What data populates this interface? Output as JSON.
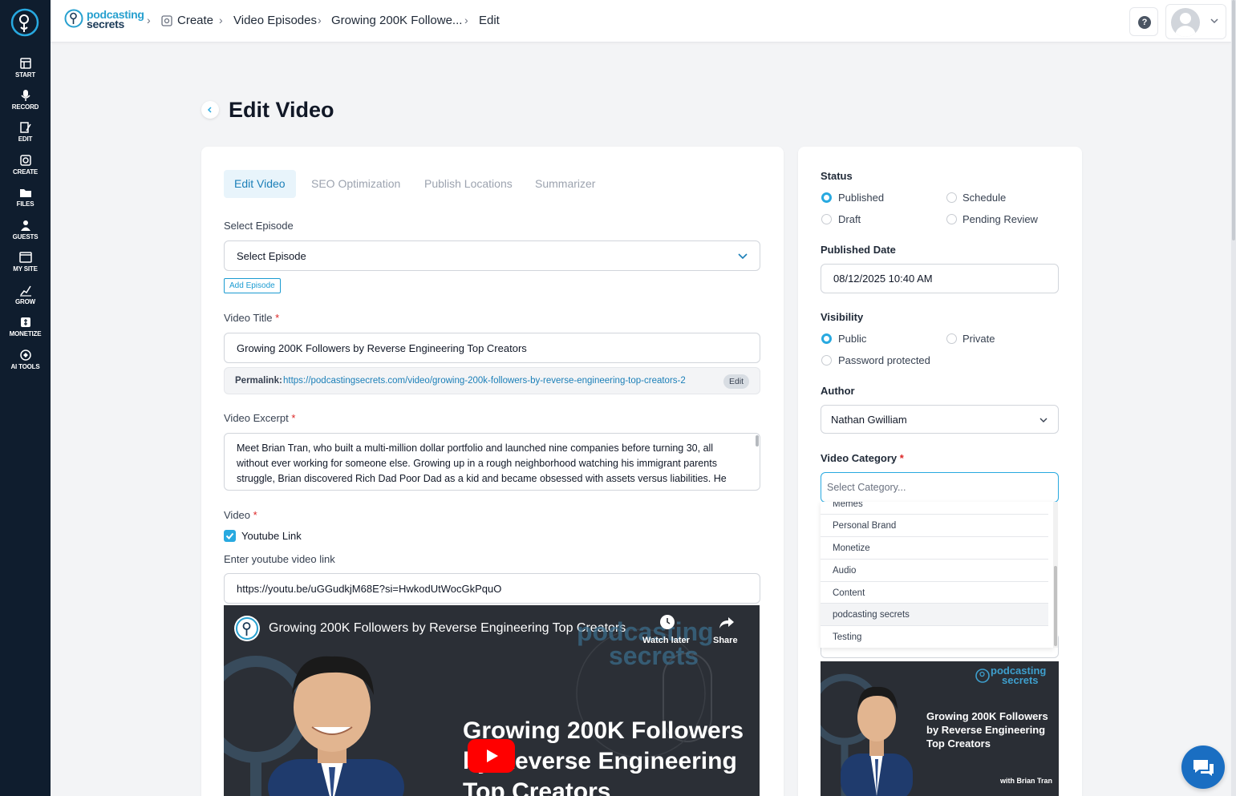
{
  "sidebar": {
    "items": [
      {
        "label": "START",
        "icon": "start-icon"
      },
      {
        "label": "RECORD",
        "icon": "microphone-icon"
      },
      {
        "label": "EDIT",
        "icon": "edit-icon"
      },
      {
        "label": "CREATE",
        "icon": "create-icon"
      },
      {
        "label": "FILES",
        "icon": "folder-icon"
      },
      {
        "label": "GUESTS",
        "icon": "guests-icon"
      },
      {
        "label": "MY SITE",
        "icon": "site-icon"
      },
      {
        "label": "GROW",
        "icon": "chart-icon"
      },
      {
        "label": "MONETIZE",
        "icon": "money-icon"
      },
      {
        "label": "AI TOOLS",
        "icon": "ai-icon"
      }
    ]
  },
  "header": {
    "brand_line1": "podcasting",
    "brand_line2": "secrets",
    "breadcrumbs": [
      "Create",
      "Video Episodes",
      "Growing 200K Followe...",
      "Edit"
    ],
    "help_label": "?"
  },
  "page": {
    "title": "Edit Video"
  },
  "tabs": [
    "Edit Video",
    "SEO Optimization",
    "Publish Locations",
    "Summarizer"
  ],
  "form": {
    "select_episode_label": "Select Episode",
    "select_episode_value": "Select Episode",
    "add_episode_label": "Add Episode",
    "video_title_label": "Video Title",
    "required_mark": "*",
    "video_title_value": "Growing 200K Followers by Reverse Engineering Top Creators",
    "permalink_label": "Permalink:",
    "permalink_url": "https://podcastingsecrets.com/video/growing-200k-followers-by-reverse-engineering-top-creators-2",
    "permalink_edit": "Edit",
    "excerpt_label": "Video Excerpt",
    "excerpt_value": "Meet Brian Tran, who built a multi-million dollar portfolio and launched nine companies before turning 30, all without ever working for someone else. Growing up in a rough neighborhood watching his immigrant parents struggle, Brian discovered Rich Dad Poor Dad as a kid and became obsessed with assets versus liabilities. He",
    "video_label": "Video",
    "youtube_checkbox_label": "Youtube Link",
    "youtube_link_label": "Enter youtube video link",
    "youtube_link_value": "https://youtu.be/uGGudkjM68E?si=HwkodUtWocGkPquO"
  },
  "video_preview": {
    "title": "Growing 200K Followers by Reverse Engineering Top Creators",
    "watch_later": "Watch later",
    "share": "Share",
    "watermark_line1": "podcasting",
    "watermark_line2": "secrets",
    "headline_line1": "Growing 200K Followers",
    "headline_line2": "by Reverse Engineering",
    "headline_line3": "Top Creators"
  },
  "side": {
    "status_label": "Status",
    "status_options": [
      "Published",
      "Schedule",
      "Draft",
      "Pending Review"
    ],
    "status_selected": "Published",
    "published_date_label": "Published Date",
    "published_date_value": "08/12/2025 10:40 AM",
    "visibility_label": "Visibility",
    "visibility_options": [
      "Public",
      "Private",
      "Password protected"
    ],
    "visibility_selected": "Public",
    "author_label": "Author",
    "author_value": "Nathan Gwilliam",
    "category_label": "Video Category",
    "category_placeholder": "Select Category...",
    "category_options": [
      "Memes",
      "Personal Brand",
      "Monetize",
      "Audio",
      "Content",
      "podcasting secrets",
      "Testing"
    ],
    "category_highlighted": "podcasting secrets"
  },
  "thumbnail": {
    "brand_line1": "podcasting",
    "brand_line2": "secrets",
    "headline_line1": "Growing 200K Followers",
    "headline_line2": "by Reverse Engineering",
    "headline_line3": "Top Creators",
    "with_text": "with Brian Tran"
  },
  "colors": {
    "sidebar_bg": "#0f1d2e",
    "accent": "#28a9e0",
    "link": "#1b7fb8",
    "required": "#dc2626",
    "chat_button": "#1a6ec2"
  }
}
